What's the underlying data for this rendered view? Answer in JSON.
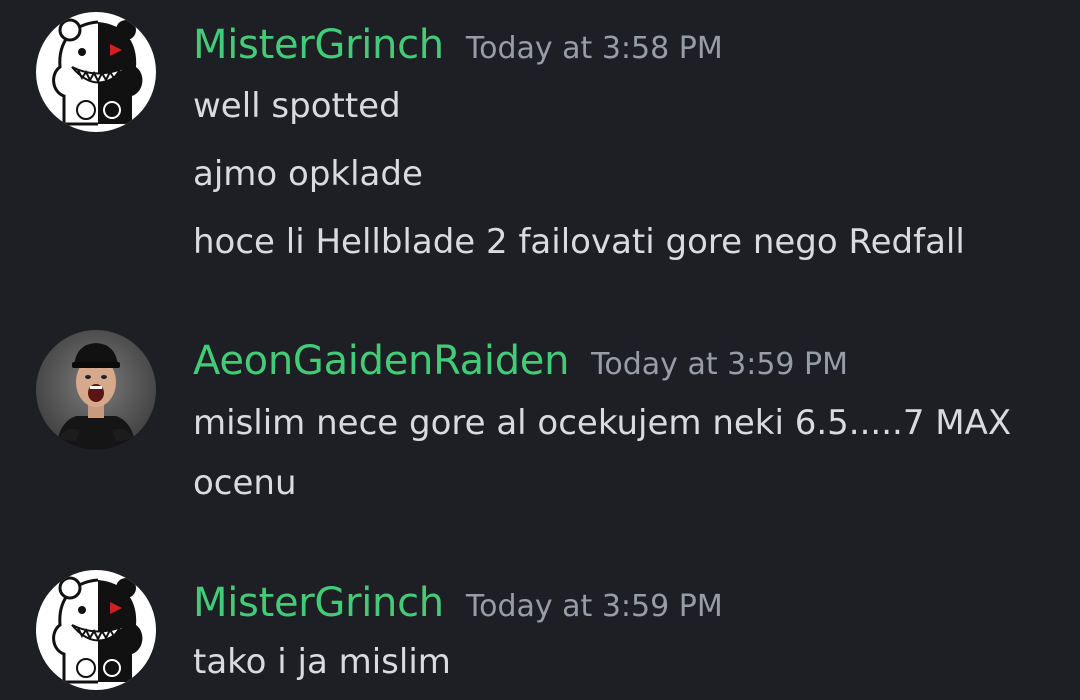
{
  "colors": {
    "background": "#1e1f25",
    "username": "#43cc78",
    "timestamp": "#9a9ca5",
    "message_text": "#dadbdf"
  },
  "messages": [
    {
      "username": "MisterGrinch",
      "timestamp": "Today at 3:58 PM",
      "avatar_icon": "monokuma-bear-avatar",
      "lines": [
        "well spotted",
        "ajmo opklade",
        "hoce li Hellblade 2 failovati gore nego Redfall"
      ]
    },
    {
      "username": "AeonGaidenRaiden",
      "timestamp": "Today at 3:59 PM",
      "avatar_icon": "screaming-man-cap-avatar",
      "lines": [
        "mislim nece gore al ocekujem neki 6.5.....7 MAX",
        "ocenu"
      ]
    },
    {
      "username": "MisterGrinch",
      "timestamp": "Today at 3:59 PM",
      "avatar_icon": "monokuma-bear-avatar",
      "lines": [
        "tako i ja mislim"
      ]
    }
  ]
}
